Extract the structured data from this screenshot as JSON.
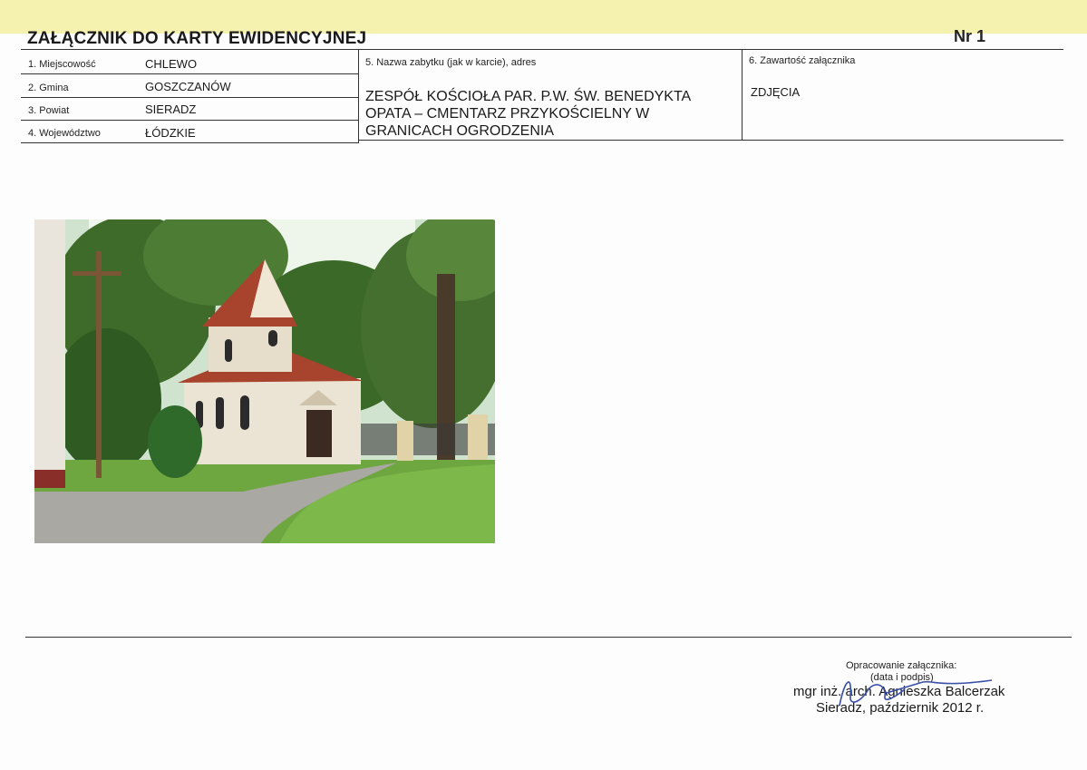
{
  "header": {
    "title": "ZAŁĄCZNIK DO KARTY EWIDENCYJNEJ",
    "number": "Nr 1"
  },
  "fields": {
    "miejscowosc": {
      "label": "1. Miejscowość",
      "value": "CHLEWO"
    },
    "gmina": {
      "label": "2. Gmina",
      "value": "GOSZCZANÓW"
    },
    "powiat": {
      "label": "3. Powiat",
      "value": "SIERADZ"
    },
    "wojewodztwo": {
      "label": "4. Województwo",
      "value": "ŁÓDZKIE"
    },
    "nazwa": {
      "label": "5. Nazwa zabytku (jak w karcie), adres",
      "lines": [
        "ZESPÓŁ KOŚCIOŁA PAR. P.W. ŚW. BENEDYKTA",
        "OPATA – CMENTARZ PRZYKOŚCIELNY W",
        "GRANICACH OGRODZENIA"
      ]
    },
    "zawartosc": {
      "label": "6. Zawartość załącznika",
      "value": "ZDJĘCIA"
    }
  },
  "photo": {
    "subject": "church-chapel-photo"
  },
  "footer": {
    "prepared_label": "Opracowanie załącznika:",
    "date_sign_label": "(data i podpis)",
    "author": "mgr inż. arch. Agnieszka Balcerzak",
    "place_date": "Sieradz, październik 2012 r."
  },
  "colors": {
    "top_band": "#f5f2b0",
    "rule": "#333333"
  }
}
